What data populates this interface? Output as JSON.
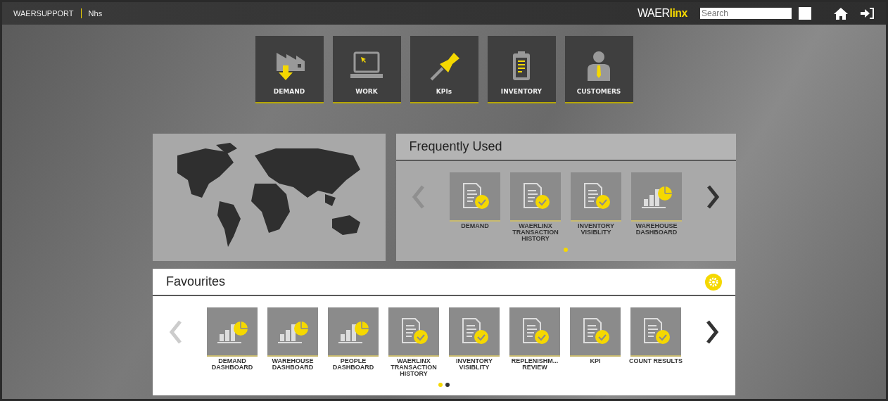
{
  "top_bar": {
    "user": "WAERSUPPORT",
    "site": "Nhs",
    "logo": {
      "main": "WAER",
      "accent": "linx"
    },
    "search": {
      "placeholder": "Search"
    }
  },
  "modules": [
    {
      "label": "DEMAND",
      "kind": "demand"
    },
    {
      "label": "WORK",
      "kind": "work"
    },
    {
      "label": "KPIs",
      "kind": "kpi"
    },
    {
      "label": "INVENTORY",
      "kind": "inventory"
    },
    {
      "label": "CUSTOMERS",
      "kind": "customers"
    }
  ],
  "frequently_used": {
    "title": "Frequently Used",
    "items": [
      {
        "label": "DEMAND",
        "kind": "report"
      },
      {
        "label": "WAERLINX TRANSACTION HISTORY",
        "kind": "report"
      },
      {
        "label": "INVENTORY VISIBLITY",
        "kind": "report"
      },
      {
        "label": "WAREHOUSE DASHBOARD",
        "kind": "chart"
      }
    ],
    "pages": [
      {
        "selected": true
      }
    ]
  },
  "favourites": {
    "title": "Favourites",
    "items": [
      {
        "label": "DEMAND DASHBOARD",
        "kind": "chart"
      },
      {
        "label": "WAREHOUSE DASHBOARD",
        "kind": "chart"
      },
      {
        "label": "PEOPLE DASHBOARD",
        "kind": "chart"
      },
      {
        "label": "WAERLINX TRANSACTION HISTORY",
        "kind": "report"
      },
      {
        "label": "INVENTORY VISIBLITY",
        "kind": "report"
      },
      {
        "label": "REPLENISHM... REVIEW",
        "kind": "report"
      },
      {
        "label": "KPI",
        "kind": "report"
      },
      {
        "label": "COUNT RESULTS",
        "kind": "report"
      }
    ],
    "pages": [
      {
        "selected": true
      },
      {
        "selected": false
      }
    ]
  }
}
